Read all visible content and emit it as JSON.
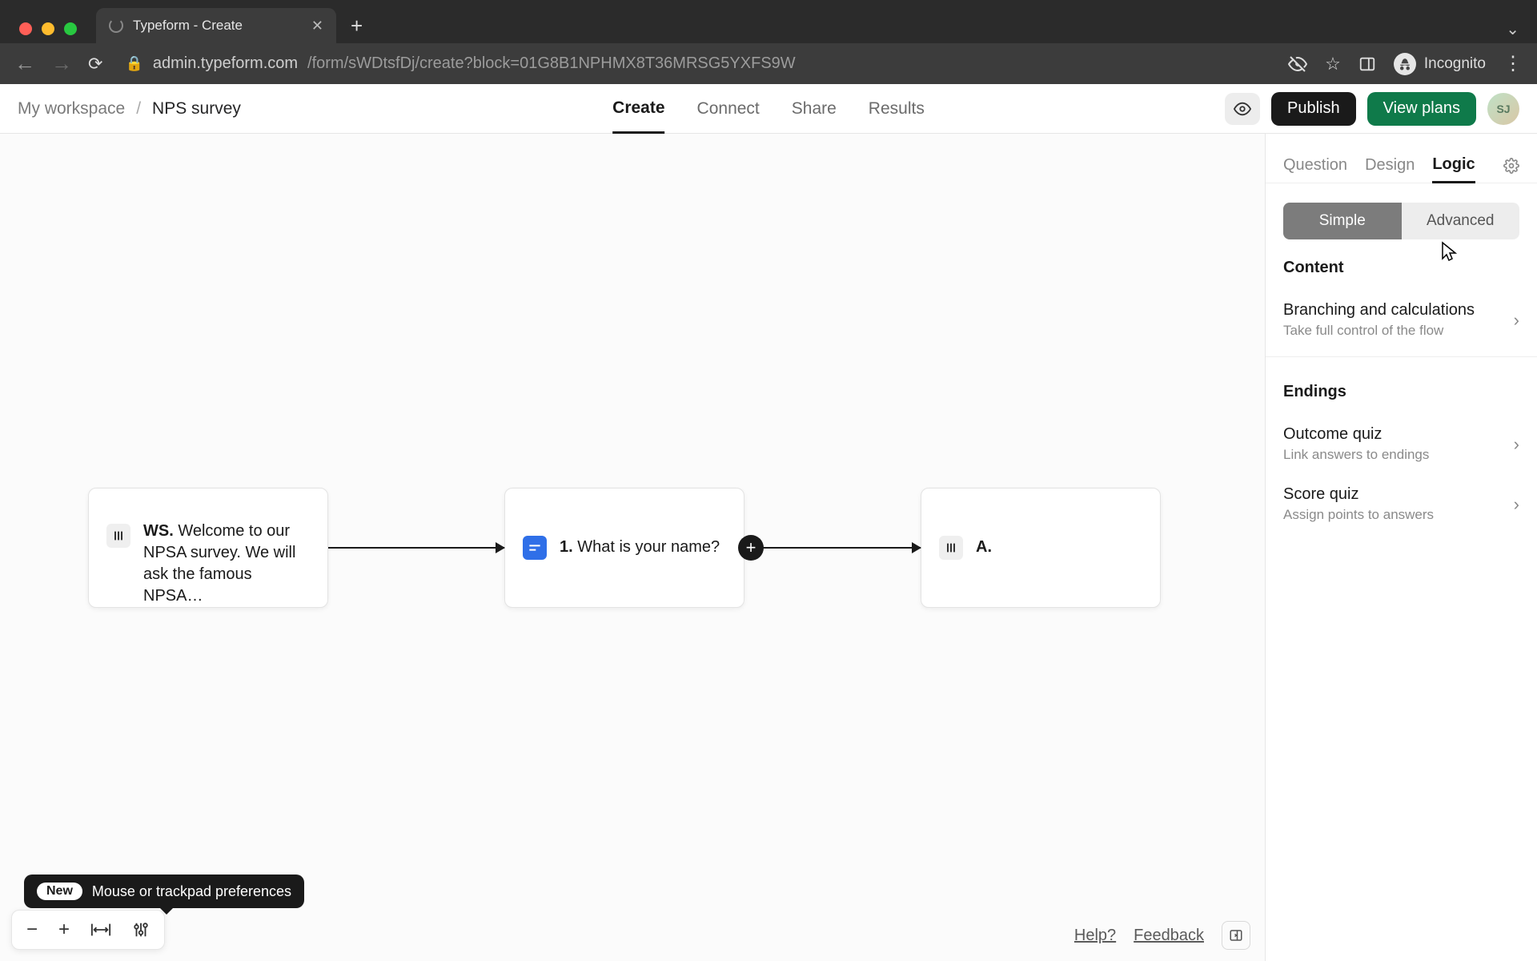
{
  "browser": {
    "tab_title": "Typeform - Create",
    "url_host": "admin.typeform.com",
    "url_path": "/form/sWDtsfDj/create?block=01G8B1NPHMX8T36MRSG5YXFS9W",
    "incognito_label": "Incognito"
  },
  "header": {
    "workspace": "My workspace",
    "form_name": "NPS survey",
    "tabs": [
      "Create",
      "Connect",
      "Share",
      "Results"
    ],
    "active_tab": "Create",
    "publish": "Publish",
    "view_plans": "View plans",
    "avatar_initials": "SJ"
  },
  "panel": {
    "tabs": [
      "Question",
      "Design",
      "Logic"
    ],
    "active_tab": "Logic",
    "segmented": {
      "simple": "Simple",
      "advanced": "Advanced",
      "active": "Simple"
    },
    "sections": {
      "content_title": "Content",
      "branching_title": "Branching and calculations",
      "branching_sub": "Take full control of the flow",
      "endings_title": "Endings",
      "outcome_title": "Outcome quiz",
      "outcome_sub": "Link answers to endings",
      "score_title": "Score quiz",
      "score_sub": "Assign points to answers"
    }
  },
  "flow": {
    "ws_prefix": "WS.",
    "ws_text": "Welcome to our NPSA survey. We will ask the famous NPSA…",
    "q1_prefix": "1.",
    "q1_text": "What is your name?",
    "end_prefix": "A."
  },
  "tooltip": {
    "badge": "New",
    "text": "Mouse or trackpad preferences"
  },
  "footer": {
    "help": "Help?",
    "feedback": "Feedback"
  }
}
